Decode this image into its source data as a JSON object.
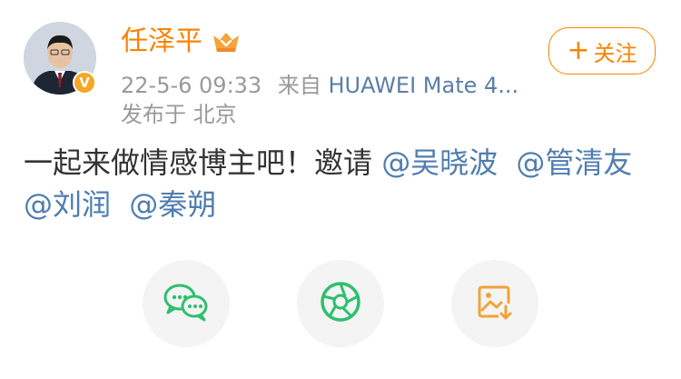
{
  "user": {
    "name": "任泽平",
    "verified_badge": "V",
    "badge_color": "#f5a623",
    "member_icon": "vip-member-icon"
  },
  "meta": {
    "time": "22-5-6 09:33",
    "source_prefix": "来自",
    "device": "HUAWEI Mate 4...",
    "location": "发布于 北京"
  },
  "follow": {
    "plus": "+",
    "label": "关注"
  },
  "post": {
    "text": "一起来做情感博主吧！邀请",
    "mentions": [
      "@吴晓波",
      "@管清友",
      "@刘润",
      "@秦朔"
    ]
  },
  "share": {
    "icons": [
      "wechat-icon",
      "moments-icon",
      "save-image-icon"
    ]
  },
  "colors": {
    "accent_orange": "#ff8200",
    "link_blue": "#507daf",
    "text_dark": "#333333",
    "text_gray": "#999999"
  }
}
